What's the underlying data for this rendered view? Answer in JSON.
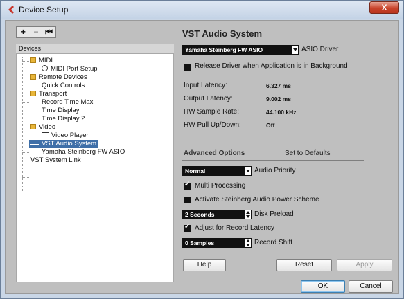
{
  "window": {
    "title": "Device Setup",
    "close_label": "X"
  },
  "toolbar": {
    "add": "+",
    "remove": "−",
    "reset": "⏮"
  },
  "devices": {
    "header": "Devices",
    "tree": [
      {
        "label": "MIDI",
        "icon": "folder-icon"
      },
      {
        "label": "MIDI Port Setup",
        "icon": "clock-icon"
      },
      {
        "label": "Remote Devices",
        "icon": "folder-icon"
      },
      {
        "label": "Quick Controls",
        "icon": ""
      },
      {
        "label": "Transport",
        "icon": "folder-icon"
      },
      {
        "label": "Record Time Max",
        "icon": ""
      },
      {
        "label": "Time Display",
        "icon": ""
      },
      {
        "label": "Time Display 2",
        "icon": ""
      },
      {
        "label": "Video",
        "icon": "folder-icon"
      },
      {
        "label": "Video Player",
        "icon": "video-icon"
      },
      {
        "label": "VST Audio System",
        "icon": "device-icon",
        "selected": true
      },
      {
        "label": "Yamaha Steinberg FW ASIO",
        "icon": ""
      },
      {
        "label": "VST System Link",
        "icon": ""
      }
    ]
  },
  "panel": {
    "title": "VST Audio System",
    "asio_driver_value": "Yamaha Steinberg FW ASIO",
    "asio_driver_label": "ASIO Driver",
    "release_driver_label": "Release Driver when Application is in Background",
    "release_driver_checked": false,
    "input_latency_label": "Input Latency:",
    "input_latency_value": "6.327 ms",
    "output_latency_label": "Output Latency:",
    "output_latency_value": "9.002 ms",
    "sample_rate_label": "HW Sample Rate:",
    "sample_rate_value": "44.100 kHz",
    "pull_label": "HW Pull Up/Down:",
    "pull_value": "Off",
    "advanced_label": "Advanced Options",
    "defaults_label": "Set to Defaults",
    "priority_value": "Normal",
    "priority_label": "Audio Priority",
    "multi_label": "Multi Processing",
    "multi_checked": true,
    "power_label": "Activate Steinberg Audio Power Scheme",
    "power_checked": false,
    "preload_value": "2 Seconds",
    "preload_label": "Disk Preload",
    "adjust_label": "Adjust for Record Latency",
    "adjust_checked": true,
    "shift_value": "0 Samples",
    "shift_label": "Record Shift",
    "help_label": "Help",
    "reset_label": "Reset",
    "apply_label": "Apply"
  },
  "footer": {
    "ok_label": "OK",
    "cancel_label": "Cancel"
  }
}
